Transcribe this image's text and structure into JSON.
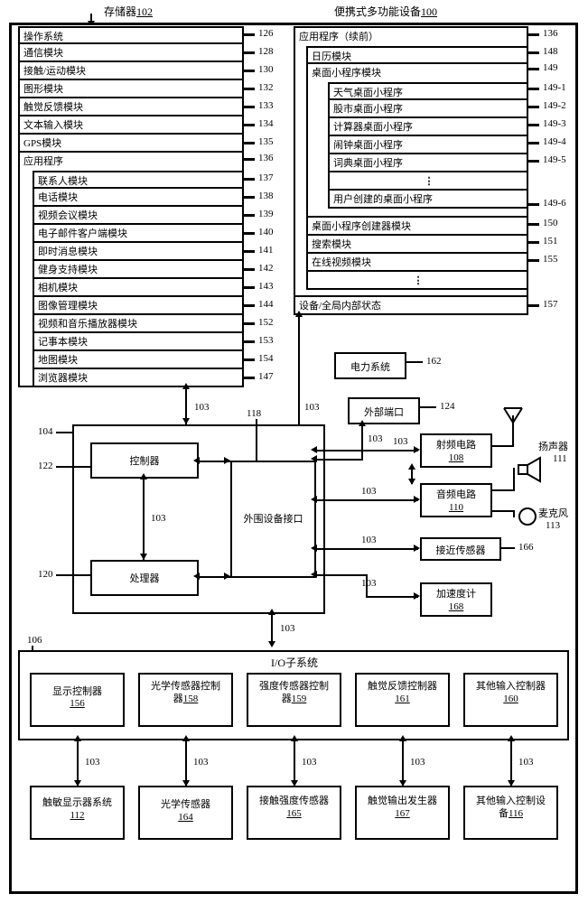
{
  "headers": {
    "memory": "存储器",
    "memory_ref": "102",
    "device": "便携式多功能设备",
    "device_ref": "100"
  },
  "memory": {
    "os": "操作系统",
    "comm": "通信模块",
    "contact_motion": "接触/运动模块",
    "graphics": "图形模块",
    "haptic_fb": "触觉反馈模块",
    "text_input": "文本输入模块",
    "gps": "GPS模块",
    "apps": "应用程序",
    "contacts": "联系人模块",
    "phone": "电话模块",
    "video_conf": "视频会议模块",
    "email": "电子邮件客户端模块",
    "im": "即时消息模块",
    "fitness": "健身支持模块",
    "camera": "相机模块",
    "img_mgmt": "图像管理模块",
    "media_player": "视频和音乐播放器模块",
    "notepad": "记事本模块",
    "maps": "地图模块",
    "browser": "浏览器模块"
  },
  "device": {
    "apps_cont": "应用程序（续前）",
    "calendar": "日历模块",
    "widgets": "桌面小程序模块",
    "weather": "天气桌面小程序",
    "stocks": "股市桌面小程序",
    "calculator": "计算器桌面小程序",
    "alarm": "闹钟桌面小程序",
    "dictionary": "词典桌面小程序",
    "user_widget": "用户创建的桌面小程序",
    "widget_creator": "桌面小程序创建器模块",
    "search": "搜索模块",
    "online_video": "在线视频模块",
    "global_state": "设备/全局内部状态"
  },
  "hw": {
    "controller": "控制器",
    "processor": "处理器",
    "periph": "外围设备接口",
    "power": "电力系统",
    "ext_port": "外部端口",
    "rf": "射频电路",
    "rf_ref": "108",
    "audio": "音频电路",
    "audio_ref": "110",
    "proximity": "接近传感器",
    "accel": "加速度计",
    "accel_ref": "168",
    "speaker": "扬声器",
    "mic": "麦克风"
  },
  "io": {
    "title": "I/O子系统",
    "disp_ctrl": "显示控制器",
    "disp_ctrl_ref": "156",
    "opt_ctrl": "光学传感器控制器",
    "opt_ctrl_ref": "158",
    "int_ctrl": "强度传感器控制器",
    "int_ctrl_ref": "159",
    "hap_ctrl": "触觉反馈控制器",
    "hap_ctrl_ref": "161",
    "other_ctrl": "其他输入控制器",
    "other_ctrl_ref": "160",
    "touch_disp": "触敏显示器系统",
    "touch_disp_ref": "112",
    "opt_sens": "光学传感器",
    "opt_sens_ref": "164",
    "int_sens": "接触强度传感器",
    "int_sens_ref": "165",
    "hap_gen": "触觉输出发生器",
    "hap_gen_ref": "167",
    "other_dev": "其他输入控制设备",
    "other_dev_ref": "116"
  },
  "nums": {
    "n126": "126",
    "n128": "128",
    "n130": "130",
    "n132": "132",
    "n133": "133",
    "n134": "134",
    "n135": "135",
    "n136": "136",
    "n137": "137",
    "n138": "138",
    "n139": "139",
    "n140": "140",
    "n141": "141",
    "n142": "142",
    "n143": "143",
    "n144": "144",
    "n152": "152",
    "n153": "153",
    "n154": "154",
    "n147": "147",
    "n148": "148",
    "n149": "149",
    "n1491": "149-1",
    "n1492": "149-2",
    "n1493": "149-3",
    "n1494": "149-4",
    "n1495": "149-5",
    "n1496": "149-6",
    "n150": "150",
    "n151": "151",
    "n155": "155",
    "n157": "157",
    "n162": "162",
    "n124": "124",
    "n166": "166",
    "n111": "111",
    "n113": "113",
    "n103": "103",
    "n104": "104",
    "n106": "106",
    "n118": "118",
    "n120": "120",
    "n122": "122"
  }
}
